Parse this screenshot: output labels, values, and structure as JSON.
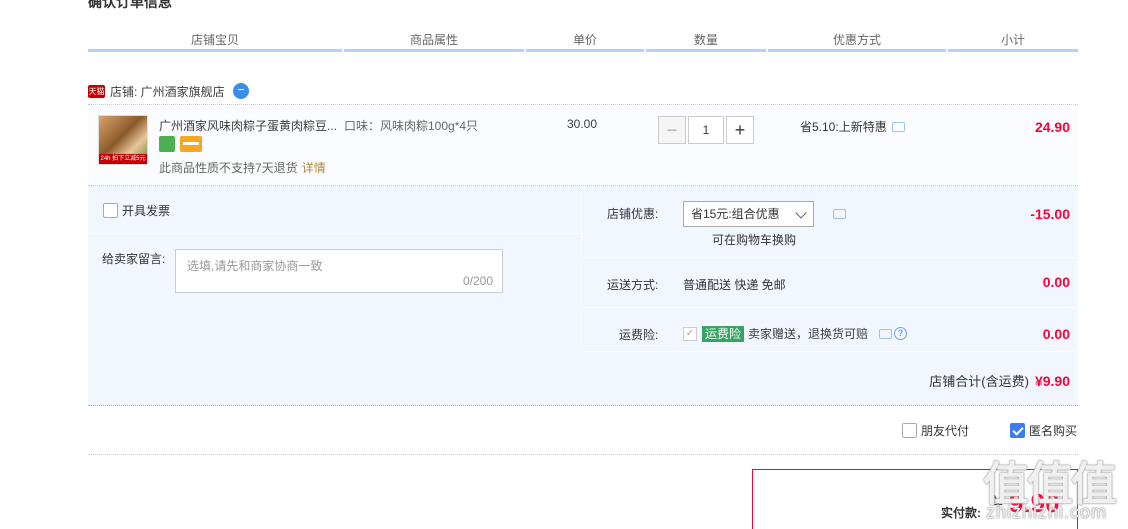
{
  "page_title": "确认订单信息",
  "columns": [
    "店铺宝贝",
    "商品属性",
    "单价",
    "数量",
    "优惠方式",
    "小计"
  ],
  "shop": {
    "badge": "天猫",
    "label": "店铺: 广州酒家旗舰店"
  },
  "item": {
    "thumb_badge": "24h 拍下立减5元",
    "title": "广州酒家风味肉粽子蛋黄肉粽豆...",
    "attr": "口味：风味肉粽100g*4只",
    "price": "30.00",
    "qty_minus": "−",
    "qty": "1",
    "qty_plus": "+",
    "promo": "省5.10:上新特惠",
    "subtotal": "24.90",
    "return_note": "此商品性质不支持7天退货",
    "detail_link": "详情"
  },
  "invoice_label": "开具发票",
  "message": {
    "label": "给卖家留言:",
    "placeholder": "选填,请先和商家协商一致",
    "count": "0/200"
  },
  "store_discount": {
    "label": "店铺优惠:",
    "selected": "省15元:组合优惠",
    "hint": "可在购物车换购",
    "value": "-15.00"
  },
  "shipping": {
    "label": "运送方式:",
    "text": "普通配送 快递 免邮",
    "value": "0.00"
  },
  "insurance": {
    "label": "运费险:",
    "badge": "运费险",
    "text": "卖家赠送，退换货可赔",
    "help": "?",
    "value": "0.00"
  },
  "store_total": {
    "label": "店铺合计(含运费)",
    "amount": "¥9.90"
  },
  "options": {
    "friend_pay": "朋友代付",
    "anonymous": "匿名购买"
  },
  "payment": {
    "label": "实付款:",
    "currency": "¥",
    "amount": "9.90"
  },
  "watermark": {
    "logo": "值值值",
    "text": "zhizhizhi.com"
  },
  "colors": {
    "accent_red": "#ff0036",
    "header_line": "#b2d1ff",
    "panel_bg": "#f2f7ff",
    "checkbox_checked": "#3b7dec"
  }
}
